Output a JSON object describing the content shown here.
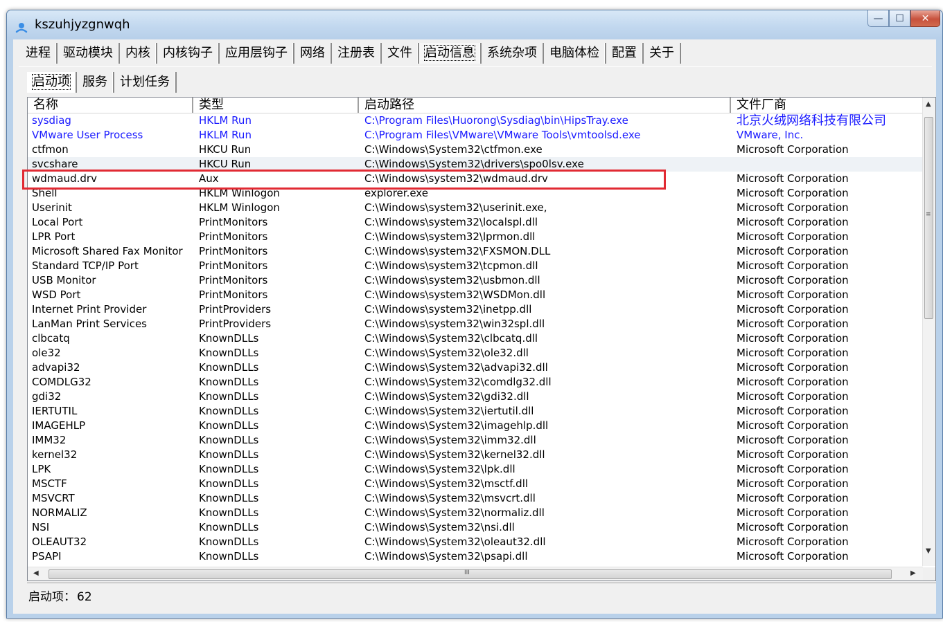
{
  "window": {
    "title": "kszuhjyzgnwqh",
    "buttons": {
      "minimize": "—",
      "maximize": "☐",
      "close": "✕"
    }
  },
  "main_tabs": [
    "进程",
    "驱动模块",
    "内核",
    "内核钩子",
    "应用层钩子",
    "网络",
    "注册表",
    "文件",
    "启动信息",
    "系统杂项",
    "电脑体检",
    "配置",
    "关于"
  ],
  "main_tab_active": "启动信息",
  "sub_tabs": [
    "启动项",
    "服务",
    "计划任务"
  ],
  "sub_tab_active": "启动项",
  "columns": [
    "名称",
    "类型",
    "启动路径",
    "文件厂商"
  ],
  "rows": [
    [
      "sysdiag",
      "HKLM Run",
      "C:\\Program Files\\Huorong\\Sysdiag\\bin\\HipsTray.exe",
      "北京火绒网络科技有限公司"
    ],
    [
      "VMware User Process",
      "HKLM Run",
      "C:\\Program Files\\VMware\\VMware Tools\\vmtoolsd.exe",
      "VMware, Inc."
    ],
    [
      "ctfmon",
      "HKCU Run",
      "C:\\Windows\\System32\\ctfmon.exe",
      "Microsoft Corporation"
    ],
    [
      "svcshare",
      "HKCU Run",
      "C:\\Windows\\System32\\drivers\\spo0lsv.exe",
      ""
    ],
    [
      "wdmaud.drv",
      "Aux",
      "C:\\Windows\\system32\\wdmaud.drv",
      "Microsoft Corporation"
    ],
    [
      "Shell",
      "HKLM Winlogon",
      "explorer.exe",
      "Microsoft Corporation"
    ],
    [
      "Userinit",
      "HKLM Winlogon",
      "C:\\Windows\\system32\\userinit.exe,",
      "Microsoft Corporation"
    ],
    [
      "Local Port",
      "PrintMonitors",
      "C:\\Windows\\system32\\localspl.dll",
      "Microsoft Corporation"
    ],
    [
      "LPR Port",
      "PrintMonitors",
      "C:\\Windows\\system32\\lprmon.dll",
      "Microsoft Corporation"
    ],
    [
      "Microsoft Shared Fax Monitor",
      "PrintMonitors",
      "C:\\Windows\\system32\\FXSMON.DLL",
      "Microsoft Corporation"
    ],
    [
      "Standard TCP/IP Port",
      "PrintMonitors",
      "C:\\Windows\\system32\\tcpmon.dll",
      "Microsoft Corporation"
    ],
    [
      "USB Monitor",
      "PrintMonitors",
      "C:\\Windows\\system32\\usbmon.dll",
      "Microsoft Corporation"
    ],
    [
      "WSD Port",
      "PrintMonitors",
      "C:\\Windows\\system32\\WSDMon.dll",
      "Microsoft Corporation"
    ],
    [
      "Internet Print Provider",
      "PrintProviders",
      "C:\\Windows\\system32\\inetpp.dll",
      "Microsoft Corporation"
    ],
    [
      "LanMan Print Services",
      "PrintProviders",
      "C:\\Windows\\system32\\win32spl.dll",
      "Microsoft Corporation"
    ],
    [
      "clbcatq",
      "KnownDLLs",
      "C:\\Windows\\System32\\clbcatq.dll",
      "Microsoft Corporation"
    ],
    [
      "ole32",
      "KnownDLLs",
      "C:\\Windows\\System32\\ole32.dll",
      "Microsoft Corporation"
    ],
    [
      "advapi32",
      "KnownDLLs",
      "C:\\Windows\\System32\\advapi32.dll",
      "Microsoft Corporation"
    ],
    [
      "COMDLG32",
      "KnownDLLs",
      "C:\\Windows\\System32\\comdlg32.dll",
      "Microsoft Corporation"
    ],
    [
      "gdi32",
      "KnownDLLs",
      "C:\\Windows\\System32\\gdi32.dll",
      "Microsoft Corporation"
    ],
    [
      "IERTUTIL",
      "KnownDLLs",
      "C:\\Windows\\System32\\iertutil.dll",
      "Microsoft Corporation"
    ],
    [
      "IMAGEHLP",
      "KnownDLLs",
      "C:\\Windows\\System32\\imagehlp.dll",
      "Microsoft Corporation"
    ],
    [
      "IMM32",
      "KnownDLLs",
      "C:\\Windows\\System32\\imm32.dll",
      "Microsoft Corporation"
    ],
    [
      "kernel32",
      "KnownDLLs",
      "C:\\Windows\\System32\\kernel32.dll",
      "Microsoft Corporation"
    ],
    [
      "LPK",
      "KnownDLLs",
      "C:\\Windows\\System32\\lpk.dll",
      "Microsoft Corporation"
    ],
    [
      "MSCTF",
      "KnownDLLs",
      "C:\\Windows\\System32\\msctf.dll",
      "Microsoft Corporation"
    ],
    [
      "MSVCRT",
      "KnownDLLs",
      "C:\\Windows\\System32\\msvcrt.dll",
      "Microsoft Corporation"
    ],
    [
      "NORMALIZ",
      "KnownDLLs",
      "C:\\Windows\\System32\\normaliz.dll",
      "Microsoft Corporation"
    ],
    [
      "NSI",
      "KnownDLLs",
      "C:\\Windows\\System32\\nsi.dll",
      "Microsoft Corporation"
    ],
    [
      "OLEAUT32",
      "KnownDLLs",
      "C:\\Windows\\System32\\oleaut32.dll",
      "Microsoft Corporation"
    ],
    [
      "PSAPI",
      "KnownDLLs",
      "C:\\Windows\\System32\\psapi.dll",
      "Microsoft Corporation"
    ]
  ],
  "blue_rows": [
    0,
    1
  ],
  "selected_row": 3,
  "highlighted_row": 3,
  "status": {
    "label": "启动项：",
    "count": "62"
  },
  "colors": {
    "link_blue": "#1a1aff",
    "highlight_red": "#e12a33",
    "window_frame": "#b9d1ea"
  },
  "icons": {
    "app": "app-icon",
    "scroll_up": "scroll-up-arrow-icon",
    "scroll_down": "scroll-down-arrow-icon",
    "scroll_left": "scroll-left-arrow-icon",
    "scroll_right": "scroll-right-arrow-icon"
  }
}
